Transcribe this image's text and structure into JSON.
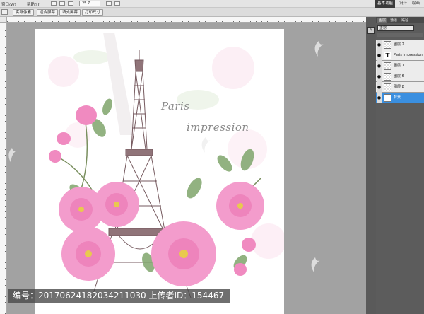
{
  "menubar": {
    "items": [
      "窗口(W)",
      "帮助(H)"
    ],
    "zoom": "25.7",
    "workspaces": [
      "基本功能",
      "设计",
      "绘画"
    ],
    "active_workspace": 0
  },
  "options": {
    "buttons": [
      "实际像素",
      "适合屏幕",
      "填充屏幕",
      "打印尺寸"
    ]
  },
  "document": {
    "text_line1": "Paris",
    "text_line2": "impression"
  },
  "layers_panel": {
    "tabs": [
      "图层",
      "通道",
      "路径"
    ],
    "blend_mode": "正常",
    "layers": [
      {
        "name": "图层 2",
        "type": "pixel",
        "selected": false
      },
      {
        "name": "Paris impression",
        "type": "text",
        "selected": false
      },
      {
        "name": "图层 7",
        "type": "pixel",
        "selected": false
      },
      {
        "name": "图层 6",
        "type": "pixel",
        "selected": false
      },
      {
        "name": "图层 8",
        "type": "pixel",
        "selected": false
      },
      {
        "name": "背景",
        "type": "background",
        "selected": true
      }
    ]
  },
  "watermark": {
    "text": "编号：20170624182034211030 上传者ID：154467"
  },
  "colors": {
    "selected_layer": "#3a8fe0",
    "petal_pink": "#f28cc4",
    "tower_brown": "#7a5a5f"
  }
}
